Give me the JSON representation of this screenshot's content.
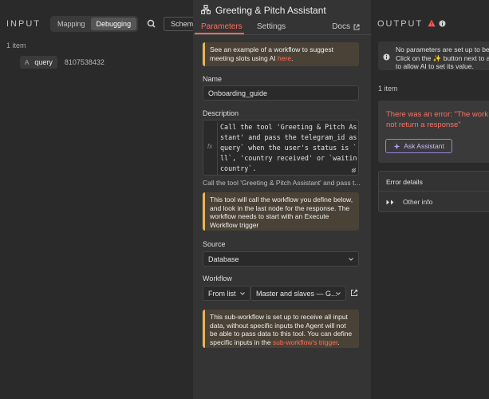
{
  "input": {
    "title": "INPUT",
    "mode_tabs": [
      "Mapping",
      "Debugging"
    ],
    "schema_label": "Schema",
    "items_count": "1 item",
    "field": {
      "type": "A",
      "name": "query",
      "value": "8107538432"
    }
  },
  "modal": {
    "title": "Greeting & Pitch Assistant",
    "tabs": {
      "parameters": "Parameters",
      "settings": "Settings"
    },
    "docs_label": "Docs",
    "example_notice": {
      "text": "See an example of a workflow to suggest meeting slots using AI ",
      "link": "here",
      "suffix": "."
    },
    "name_label": "Name",
    "name_value": "Onboarding_guide",
    "description_label": "Description",
    "description_lines": [
      "Call the tool 'Greeting & Pitch Assi",
      "stant' and pass the telegram_id as `",
      "query` when the user's status is `nu",
      "ll`, 'country received' or `waiting_",
      "country`."
    ],
    "description_preview": "Call the tool 'Greeting & Pitch Assistant' and pass t...",
    "workflow_notice": "This tool will call the workflow you define below, and look in the last node for the response. The workflow needs to start with an Execute Workflow trigger",
    "source_label": "Source",
    "source_value": "Database",
    "workflow_label": "Workflow",
    "workflow_mode": "From list",
    "workflow_value": "Master and slaves — G...",
    "subworkflow_notice": {
      "text": "This sub-workflow is set up to receive all input data, without specific inputs the Agent will not be able to pass data to this tool. You can define specific inputs in the ",
      "link": "sub-workflow's trigger",
      "suffix": "."
    }
  },
  "output": {
    "title": "OUTPUT",
    "info_lines": [
      "No parameters are set up to be f",
      "Click on the ✨ button next to a",
      "to allow AI to set its value."
    ],
    "items_count": "1 item",
    "error_lines": [
      "There was an error: \"The work",
      "not return a response\""
    ],
    "ask_label": "Ask Assistant",
    "error_details_label": "Error details",
    "other_info_label": "Other info"
  },
  "colors": {
    "accent": "#ff6d5a",
    "warning": "#e8b45c",
    "error": "#ff6f61",
    "assistant": "#9a82e0"
  }
}
